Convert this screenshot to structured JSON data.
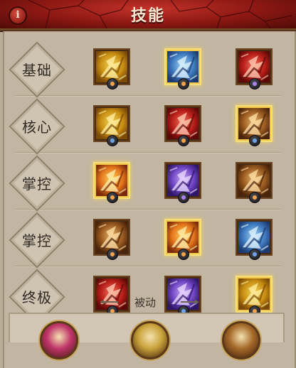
{
  "header": {
    "title": "技能",
    "info_glyph": "i",
    "color": "#8a1712"
  },
  "rows": [
    {
      "label": "基础",
      "skills": [
        {
          "icon": "golden-axe-skill-icon",
          "palette": "gold",
          "selected": false,
          "badge": "amber"
        },
        {
          "icon": "ice-axe-skill-icon",
          "palette": "blue",
          "selected": true,
          "badge": "amber"
        },
        {
          "icon": "flaming-fist-skill-icon",
          "palette": "red",
          "selected": false,
          "badge": "violet"
        }
      ]
    },
    {
      "label": "核心",
      "skills": [
        {
          "icon": "whirlwind-skill-icon",
          "palette": "gold",
          "selected": false,
          "badge": "blue"
        },
        {
          "icon": "rend-claw-skill-icon",
          "palette": "red",
          "selected": false,
          "badge": "amber"
        },
        {
          "icon": "totem-skill-icon",
          "palette": "bronze",
          "selected": true,
          "badge": "blue"
        }
      ]
    },
    {
      "label": "掌控",
      "skills": [
        {
          "icon": "fire-strike-skill-icon",
          "palette": "fire",
          "selected": true,
          "badge": "amber"
        },
        {
          "icon": "shadow-burst-skill-icon",
          "palette": "violet",
          "selected": false,
          "badge": "violet"
        },
        {
          "icon": "earth-slam-skill-icon",
          "palette": "bronze",
          "selected": false,
          "badge": "amber"
        }
      ]
    },
    {
      "label": "掌控",
      "skills": [
        {
          "icon": "ground-stomp-skill-icon",
          "palette": "bronze",
          "selected": false,
          "badge": "amber"
        },
        {
          "icon": "war-cry-skill-icon",
          "palette": "fire",
          "selected": true,
          "badge": "amber"
        },
        {
          "icon": "iron-skin-skill-icon",
          "palette": "blue",
          "selected": false,
          "badge": "blue"
        }
      ]
    },
    {
      "label": "终极",
      "skills": [
        {
          "icon": "blood-rage-skill-icon",
          "palette": "red",
          "selected": false,
          "badge": "amber"
        },
        {
          "icon": "demon-call-skill-icon",
          "palette": "violet",
          "selected": false,
          "badge": "blue"
        },
        {
          "icon": "golden-nova-skill-icon",
          "palette": "gold",
          "selected": true,
          "badge": "amber"
        }
      ]
    }
  ],
  "passive": {
    "label": "被动"
  },
  "passive_orbs": [
    {
      "icon": "crimson-passive-icon",
      "color": "#c0356a"
    },
    {
      "icon": "gold-passive-icon",
      "color": "#c9a23a"
    },
    {
      "icon": "bronze-passive-icon",
      "color": "#a56a2a"
    }
  ]
}
